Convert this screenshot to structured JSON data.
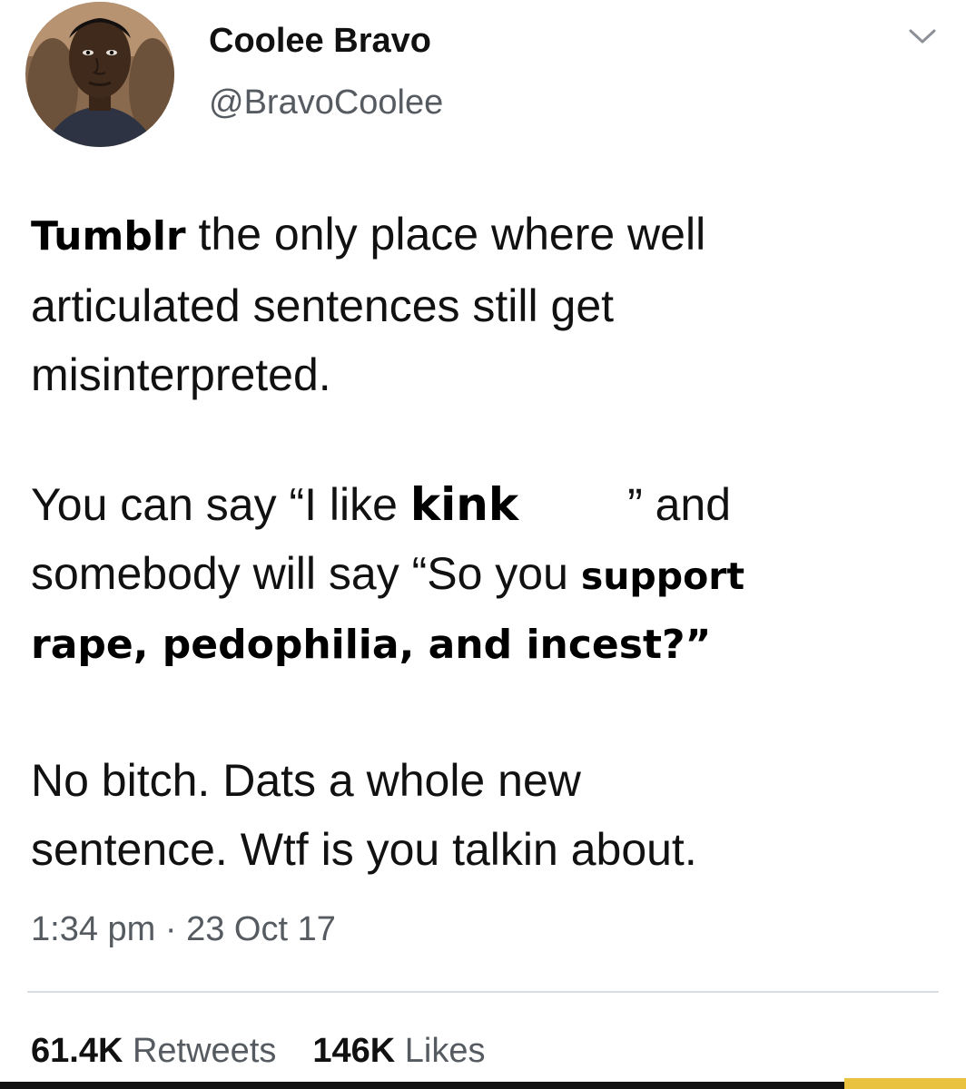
{
  "tweet": {
    "display_name": "Coolee Bravo",
    "handle": "@BravoCoolee",
    "paragraph1": {
      "bold_word": "Tumblr",
      "line1_rest": " the only place where well",
      "line2": "articulated sentences still get",
      "line3": "misinterpreted."
    },
    "paragraph2": {
      "line1_start": "You can say “I like ",
      "kink": "kink",
      "line1_end": "” and",
      "line2_start": "somebody will say “So you ",
      "support": "support",
      "line3": "rape, pedophilia, and incest?”"
    },
    "paragraph3": {
      "line1": "No bitch. Dats a whole new",
      "line2": "sentence. Wtf is you talkin about."
    },
    "timestamp": "1:34 pm · 23 Oct 17",
    "retweets_count": "61.4K",
    "retweets_label": "Retweets",
    "likes_count": "146K",
    "likes_label": "Likes"
  },
  "icons": {
    "menu": "chevron-down-icon",
    "avatar": "profile-avatar"
  },
  "colors": {
    "text_primary": "#111111",
    "text_secondary": "#555b60",
    "divider": "#d8dde1",
    "watermark": "#e9c23f"
  }
}
